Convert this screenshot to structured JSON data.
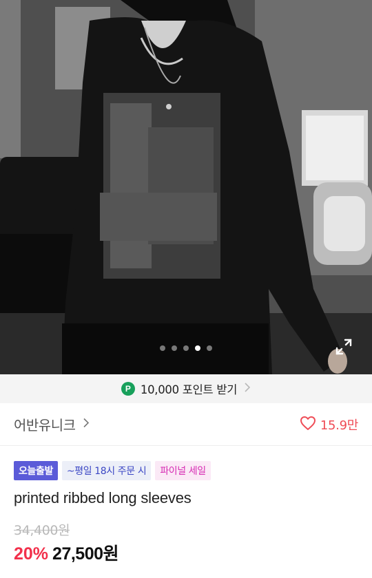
{
  "product_image": {
    "alt": "product photo",
    "carousel": {
      "count": 5,
      "active_index": 3
    }
  },
  "points_banner": {
    "badge": "P",
    "text": "10,000 포인트 받기"
  },
  "brand": {
    "name": "어반유니크",
    "like_count": "15.9만"
  },
  "badges": {
    "today_shipping": "오늘출발",
    "cutoff": "~평일 18시 주문 시",
    "final_sale": "파이널 세일"
  },
  "product": {
    "title": "printed ribbed long sleeves",
    "original_price": "34,400원",
    "discount": "20%",
    "sale_price": "27,500원"
  },
  "colors": {
    "points_badge": "#18a05b",
    "like": "#ef4c56",
    "discount": "#f2304b",
    "today_badge": "#5b5bd8"
  },
  "icons": [
    "chevron-right-icon",
    "heart-icon",
    "expand-icon"
  ]
}
